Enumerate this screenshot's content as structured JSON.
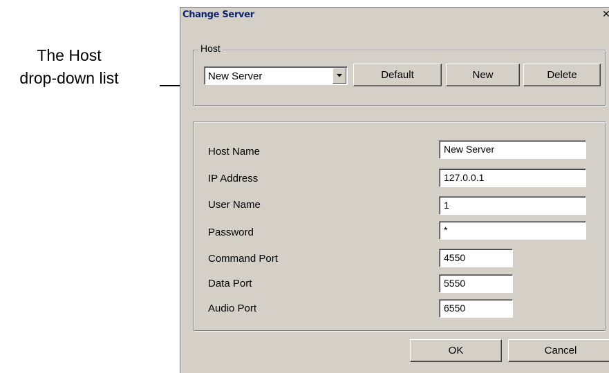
{
  "annotation": {
    "line1": "The Host",
    "line2": "drop-down list"
  },
  "dialog": {
    "title": "Change Server",
    "close_glyph": "✕",
    "host_group_label": "Host",
    "host_combo_value": "New Server",
    "buttons": {
      "default": "Default",
      "new": "New",
      "delete": "Delete",
      "ok": "OK",
      "cancel": "Cancel"
    },
    "fields": [
      {
        "label": "Host Name",
        "value": "New Server"
      },
      {
        "label": "IP Address",
        "value": "127.0.0.1"
      },
      {
        "label": "User Name",
        "value": "1"
      },
      {
        "label": "Password",
        "value": "*"
      },
      {
        "label": "Command Port",
        "value": "4550"
      },
      {
        "label": "Data Port",
        "value": "5550"
      },
      {
        "label": "Audio Port",
        "value": "6550"
      }
    ]
  }
}
